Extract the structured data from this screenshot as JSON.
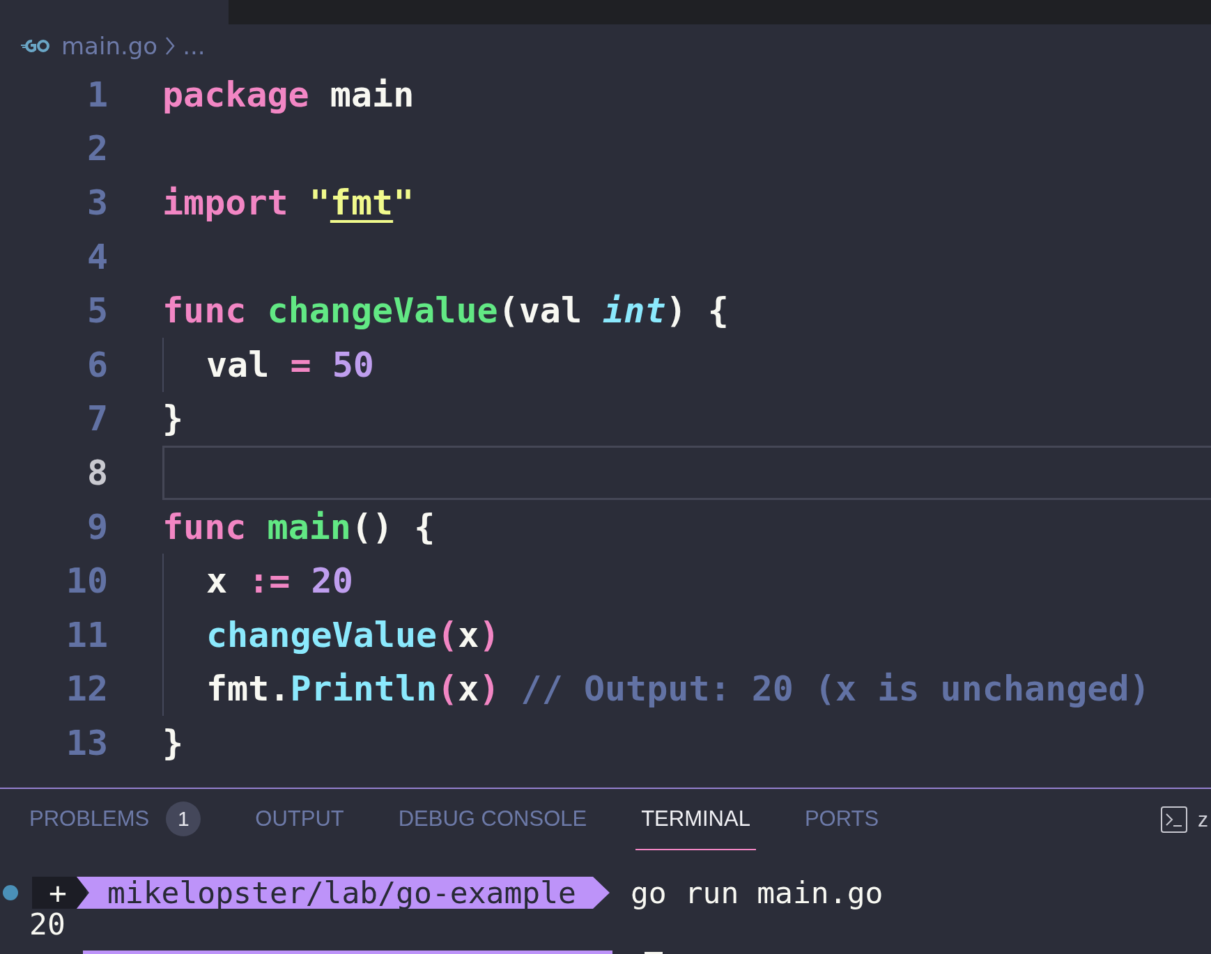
{
  "breadcrumb": {
    "file": "main.go",
    "ellipsis": "..."
  },
  "editor": {
    "lines": [
      {
        "number": "1",
        "current": false,
        "tokens": [
          {
            "kind": "keyword",
            "text": "package"
          },
          {
            "kind": "plain",
            "text": " main"
          }
        ]
      },
      {
        "number": "2",
        "current": false
      },
      {
        "number": "3",
        "current": false,
        "tokens": [
          {
            "kind": "keyword",
            "text": "import"
          },
          {
            "kind": "string",
            "text": " \""
          },
          {
            "kind": "string",
            "text": "fmt",
            "underlined": true
          },
          {
            "kind": "string",
            "text": "\""
          }
        ]
      },
      {
        "number": "4",
        "current": false
      },
      {
        "number": "5",
        "current": false,
        "tokens": [
          {
            "kind": "keyword",
            "text": "func"
          },
          {
            "kind": "function",
            "text": " changeValue"
          },
          {
            "kind": "plain",
            "text": "(val "
          },
          {
            "kind": "type",
            "text": "int"
          },
          {
            "kind": "plain",
            "text": ") {"
          }
        ]
      },
      {
        "number": "6",
        "current": false,
        "indented": true,
        "tokens": [
          {
            "kind": "plain",
            "text": "val "
          },
          {
            "kind": "keyword",
            "text": "="
          },
          {
            "kind": "number",
            "text": " 50"
          }
        ]
      },
      {
        "number": "7",
        "current": false,
        "tokens": [
          {
            "kind": "plain",
            "text": "}"
          }
        ]
      },
      {
        "number": "8",
        "current": true
      },
      {
        "number": "9",
        "current": false,
        "tokens": [
          {
            "kind": "keyword",
            "text": "func"
          },
          {
            "kind": "function",
            "text": " main"
          },
          {
            "kind": "plain",
            "text": "() {"
          }
        ]
      },
      {
        "number": "10",
        "current": false,
        "indented": true,
        "tokens": [
          {
            "kind": "plain",
            "text": "x "
          },
          {
            "kind": "keyword",
            "text": ":="
          },
          {
            "kind": "number",
            "text": " 20"
          }
        ]
      },
      {
        "number": "11",
        "current": false,
        "indented": true,
        "tokens": [
          {
            "kind": "call",
            "text": "changeValue"
          },
          {
            "kind": "keyword",
            "text": "("
          },
          {
            "kind": "plain",
            "text": "x"
          },
          {
            "kind": "keyword",
            "text": ")"
          }
        ]
      },
      {
        "number": "12",
        "current": false,
        "indented": true,
        "tokens": [
          {
            "kind": "plain",
            "text": "fmt."
          },
          {
            "kind": "call",
            "text": "Println"
          },
          {
            "kind": "keyword",
            "text": "("
          },
          {
            "kind": "plain",
            "text": "x"
          },
          {
            "kind": "keyword",
            "text": ")"
          },
          {
            "kind": "comment",
            "text": " // Output: 20 (x is unchanged)"
          }
        ]
      },
      {
        "number": "13",
        "current": false,
        "tokens": [
          {
            "kind": "plain",
            "text": "}"
          }
        ]
      }
    ]
  },
  "panel": {
    "tabs": [
      {
        "label": "PROBLEMS",
        "selected": false,
        "badge": "1"
      },
      {
        "label": "OUTPUT",
        "selected": false
      },
      {
        "label": "DEBUG CONSOLE",
        "selected": false
      },
      {
        "label": "TERMINAL",
        "selected": true
      },
      {
        "label": "PORTS",
        "selected": false
      }
    ],
    "cut_label": "z"
  },
  "terminal": {
    "prompt_symbol": "+",
    "path": "mikelopster/lab/go-example",
    "command": "go run main.go",
    "output": "20"
  }
}
